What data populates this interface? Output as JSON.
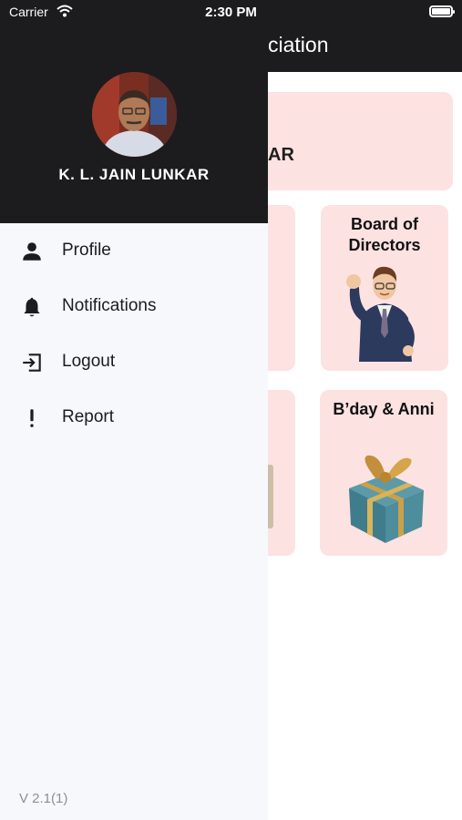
{
  "status_bar": {
    "carrier": "Carrier",
    "time": "2:30 PM"
  },
  "app": {
    "title_partial": "ciation",
    "banner_text_partial": "AR",
    "cards": [
      {
        "title_line1": "Board of",
        "title_line2": "Directors"
      },
      {
        "title_line1": "B’day & Anni",
        "title_line2": ""
      }
    ]
  },
  "drawer": {
    "user_name": "K. L. JAIN LUNKAR",
    "menu": [
      {
        "label": "Profile",
        "icon": "person-icon"
      },
      {
        "label": "Notifications",
        "icon": "bell-icon"
      },
      {
        "label": "Logout",
        "icon": "logout-icon"
      },
      {
        "label": "Report",
        "icon": "exclamation-icon"
      }
    ],
    "version": "V 2.1(1)"
  }
}
